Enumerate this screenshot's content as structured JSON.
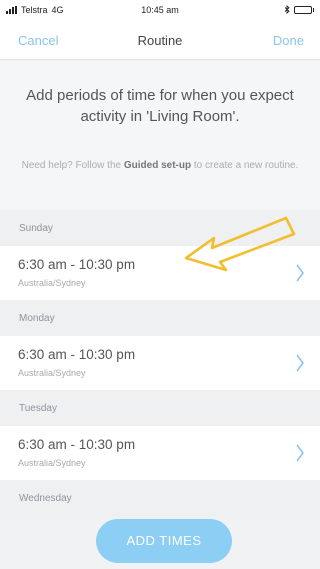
{
  "status_bar": {
    "carrier": "Telstra",
    "network": "4G",
    "time": "10:45 am",
    "bluetooth_icon": "bluetooth-icon",
    "battery_level": 0.8,
    "battery_color": "#43c05a"
  },
  "nav": {
    "cancel_label": "Cancel",
    "title": "Routine",
    "done_label": "Done"
  },
  "intro": {
    "headline": "Add periods of time for when you expect activity in 'Living Room'.",
    "help_prefix": "Need help? Follow the ",
    "help_link": "Guided set-up",
    "help_suffix": " to create a new routine."
  },
  "days": [
    {
      "day": "Sunday",
      "time_range": "6:30 am - 10:30 pm",
      "timezone": "Australia/Sydney"
    },
    {
      "day": "Monday",
      "time_range": "6:30 am - 10:30 pm",
      "timezone": "Australia/Sydney"
    },
    {
      "day": "Tuesday",
      "time_range": "6:30 am - 10:30 pm",
      "timezone": "Australia/Sydney"
    },
    {
      "day": "Wednesday"
    }
  ],
  "add_button_label": "ADD TIMES",
  "colors": {
    "accent": "#8ac4ee",
    "button": "#8ccef4",
    "annotation_arrow": "#f2be2e"
  }
}
